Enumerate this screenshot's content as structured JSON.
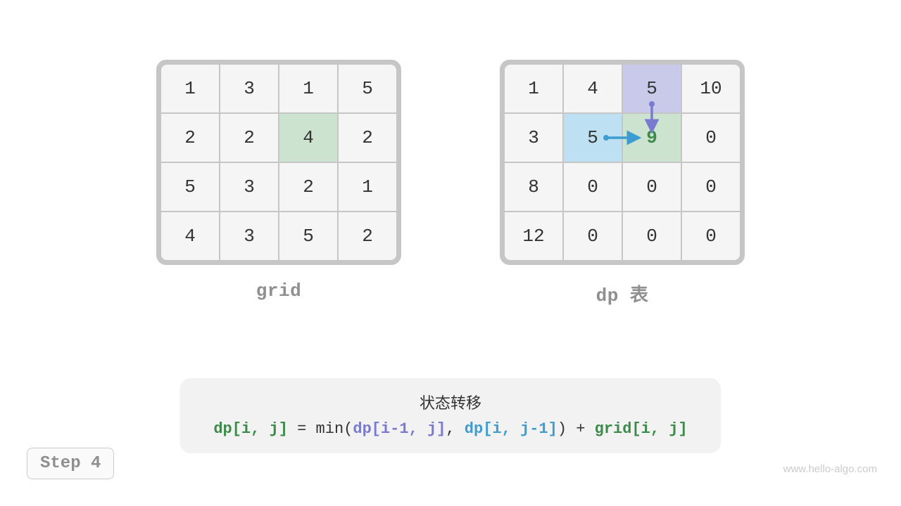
{
  "grid": {
    "label": "grid",
    "cells": [
      [
        {
          "v": "1"
        },
        {
          "v": "3"
        },
        {
          "v": "1"
        },
        {
          "v": "5"
        }
      ],
      [
        {
          "v": "2"
        },
        {
          "v": "2"
        },
        {
          "v": "4",
          "hl": "green"
        },
        {
          "v": "2"
        }
      ],
      [
        {
          "v": "5"
        },
        {
          "v": "3"
        },
        {
          "v": "2"
        },
        {
          "v": "1"
        }
      ],
      [
        {
          "v": "4"
        },
        {
          "v": "3"
        },
        {
          "v": "5"
        },
        {
          "v": "2"
        }
      ]
    ]
  },
  "dp": {
    "label": "dp 表",
    "cells": [
      [
        {
          "v": "1"
        },
        {
          "v": "4"
        },
        {
          "v": "5",
          "hl": "purple"
        },
        {
          "v": "10"
        }
      ],
      [
        {
          "v": "3"
        },
        {
          "v": "5",
          "hl": "blue"
        },
        {
          "v": "9",
          "hl": "green-text"
        },
        {
          "v": "0"
        }
      ],
      [
        {
          "v": "8"
        },
        {
          "v": "0"
        },
        {
          "v": "0"
        },
        {
          "v": "0"
        }
      ],
      [
        {
          "v": "12"
        },
        {
          "v": "0"
        },
        {
          "v": "0"
        },
        {
          "v": "0"
        }
      ]
    ]
  },
  "formula": {
    "title": "状态转移",
    "lhs": "dp[i, j]",
    "eq": " = min(",
    "a": "dp[i-1, j]",
    "comma": ", ",
    "b": "dp[i, j-1]",
    "close": ") + ",
    "rhs": "grid[i, j]"
  },
  "step": "Step 4",
  "watermark": "www.hello-algo.com",
  "colors": {
    "green": "#cce3cf",
    "blue": "#bde0f3",
    "purple": "#c9caea",
    "greentext": "#3d8b4a",
    "purpletext": "#7a7ad0",
    "bluetext": "#3d9dd0"
  }
}
